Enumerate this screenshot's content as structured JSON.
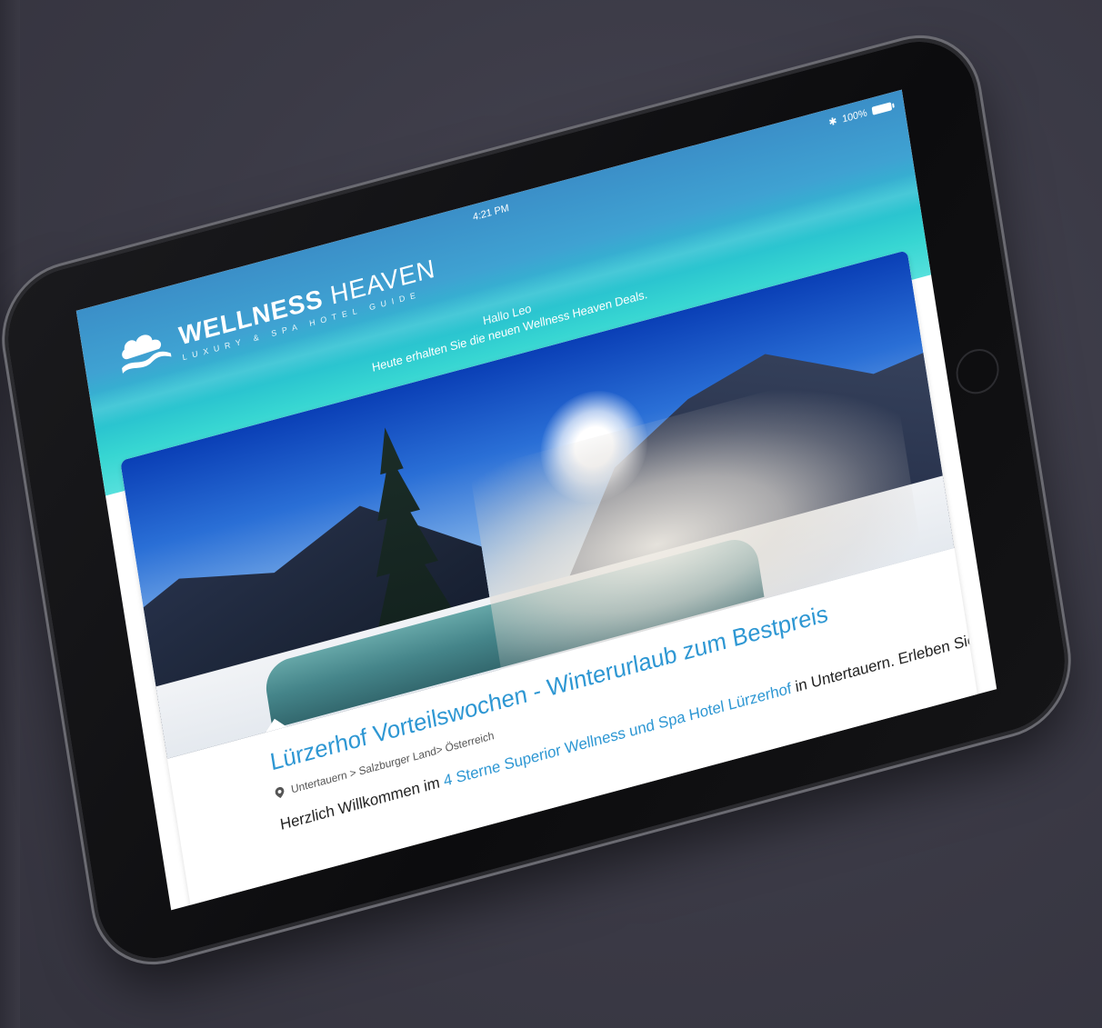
{
  "status_bar": {
    "time": "4:21 PM",
    "battery": "100%",
    "bluetooth": "✱"
  },
  "logo": {
    "title_bold": "WELLNESS",
    "title_light": "HEAVEN",
    "subtitle": "LUXURY & SPA HOTEL GUIDE"
  },
  "greeting": {
    "line1": "Hallo Leo",
    "line2": "Heute erhalten Sie die neuen Wellness Heaven Deals."
  },
  "offer": {
    "title": "Lürzerhof Vorteilswochen - Winterurlaub zum Bestpreis",
    "location": "Untertauern > Salzburger Land> Österreich",
    "welcome_prefix": "Herzlich Willkommen im ",
    "hotel_link": "4 Sterne Superior Wellness und Spa Hotel Lürzerhof",
    "welcome_suffix": " in Untertauern. Erleben Sie bei"
  },
  "colors": {
    "accent": "#2e97d3",
    "background": "#3c3b47"
  },
  "icons": {
    "location": "map-pin-icon",
    "battery": "battery-icon",
    "bluetooth": "bluetooth-icon",
    "logo": "cloud-wave-icon"
  }
}
